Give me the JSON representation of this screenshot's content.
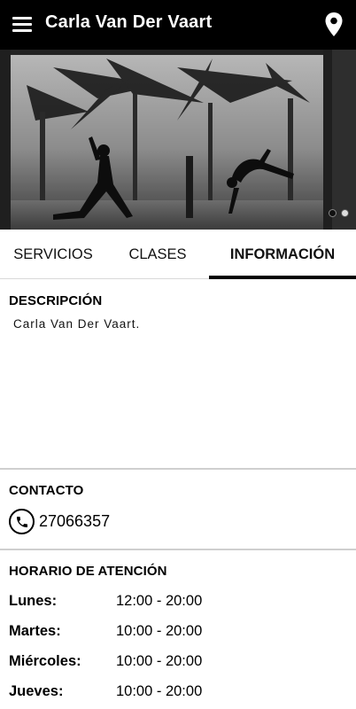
{
  "app": {
    "title": "Carla Van Der Vaart"
  },
  "tabs": [
    {
      "label": "SERVICIOS",
      "active": false
    },
    {
      "label": "CLASES",
      "active": false
    },
    {
      "label": "INFORMACIÓN",
      "active": true
    }
  ],
  "carousel": {
    "total_slides": 2,
    "active_index": 0
  },
  "description": {
    "title": "DESCRIPCIÓN",
    "text": "Carla Van Der Vaart."
  },
  "contact": {
    "title": "CONTACTO",
    "phone": "27066357"
  },
  "hours": {
    "title": "HORARIO DE ATENCIÓN",
    "rows": [
      {
        "day": "Lunes:",
        "time": "12:00 - 20:00"
      },
      {
        "day": "Martes:",
        "time": "10:00 - 20:00"
      },
      {
        "day": "Miércoles:",
        "time": "10:00 - 20:00"
      },
      {
        "day": "Jueves:",
        "time": "10:00 - 20:00"
      }
    ]
  },
  "colors": {
    "appbar": "#000000",
    "accent": "#000000",
    "divider": "#cfcfcf"
  },
  "icons": [
    "menu-icon",
    "location-pin-icon",
    "phone-icon"
  ]
}
